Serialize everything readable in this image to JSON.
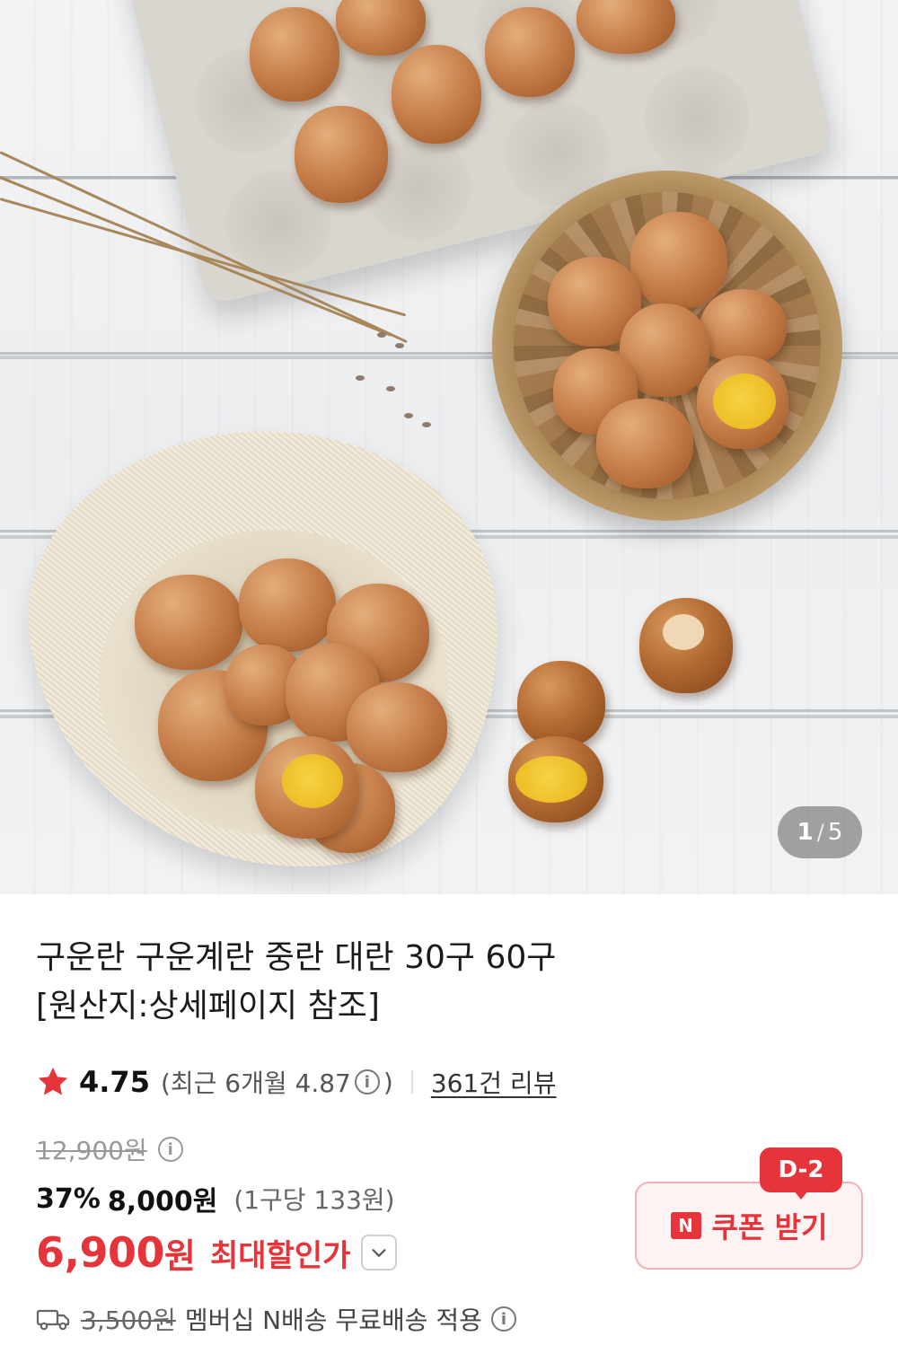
{
  "gallery": {
    "current": "1",
    "total": "5"
  },
  "product": {
    "title_line1": "구운란 구운계란 중란 대란 30구 60구",
    "title_line2": "[원산지:상세페이지 참조]"
  },
  "rating": {
    "score": "4.75",
    "recent_prefix": "(최근 6개월 4.87",
    "recent_suffix": ")",
    "review_count": "361건 리뷰"
  },
  "price": {
    "original": "12,900원",
    "discount_percent": "37%",
    "discounted": "8,000원",
    "unit_price": "(1구당 133원)",
    "final_number": "6,900",
    "final_currency": "원",
    "max_discount_label": "최대할인가"
  },
  "coupon": {
    "badge": "D-2",
    "logo": "N",
    "label": "쿠폰 받기"
  },
  "shipping": {
    "original_fee": "3,500원",
    "note": "멤버십 N배송 무료배송 적용"
  },
  "colors": {
    "accent_red": "#e5343a",
    "coupon_bg": "#fdf3f3"
  },
  "icons": [
    "star-icon",
    "info-icon",
    "chevron-down-icon",
    "truck-icon"
  ]
}
